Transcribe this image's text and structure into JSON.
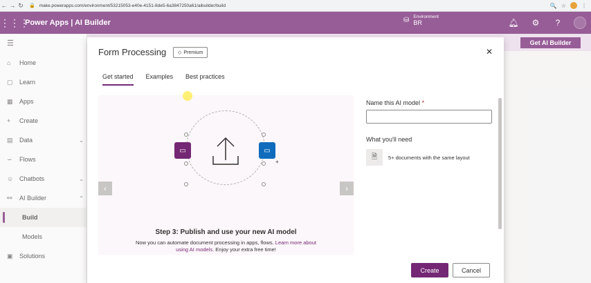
{
  "browser": {
    "url": "make.powerapps.com/environment/53215053-e40e-4151-8de5-6a3847250a61/aibuilder/build"
  },
  "header": {
    "app_title": "Power Apps | AI Builder",
    "environment_label": "Environment",
    "environment_value": "BR"
  },
  "nav": {
    "items": [
      {
        "label": "Home",
        "icon": "home-icon"
      },
      {
        "label": "Learn",
        "icon": "book-icon"
      },
      {
        "label": "Apps",
        "icon": "apps-icon"
      },
      {
        "label": "Create",
        "icon": "plus-icon"
      },
      {
        "label": "Data",
        "icon": "table-icon"
      },
      {
        "label": "Flows",
        "icon": "flow-icon"
      },
      {
        "label": "Chatbots",
        "icon": "bot-icon"
      },
      {
        "label": "AI Builder",
        "icon": "ai-icon"
      },
      {
        "label": "Build",
        "icon": ""
      },
      {
        "label": "Models",
        "icon": ""
      },
      {
        "label": "Solutions",
        "icon": "solutions-icon"
      }
    ]
  },
  "page": {
    "get_ai_builder_label": "Get AI Builder"
  },
  "modal": {
    "title": "Form Processing",
    "premium_label": "Premium",
    "tabs": [
      "Get started",
      "Examples",
      "Best practices"
    ],
    "step_title": "Step 3: Publish and use your new AI model",
    "step_desc_prefix": "Now you can automate document processing in apps, flows. ",
    "step_desc_link": "Learn more about using AI models.",
    "step_desc_suffix": " Enjoy your extra free time!",
    "name_label": "Name this AI model",
    "required_mark": "*",
    "name_value": "",
    "need_heading": "What you'll need",
    "need_item": "5+ documents with the same layout",
    "create_label": "Create",
    "cancel_label": "Cancel"
  },
  "colors": {
    "brand": "#742774",
    "accent_blue": "#0f6cbd"
  }
}
